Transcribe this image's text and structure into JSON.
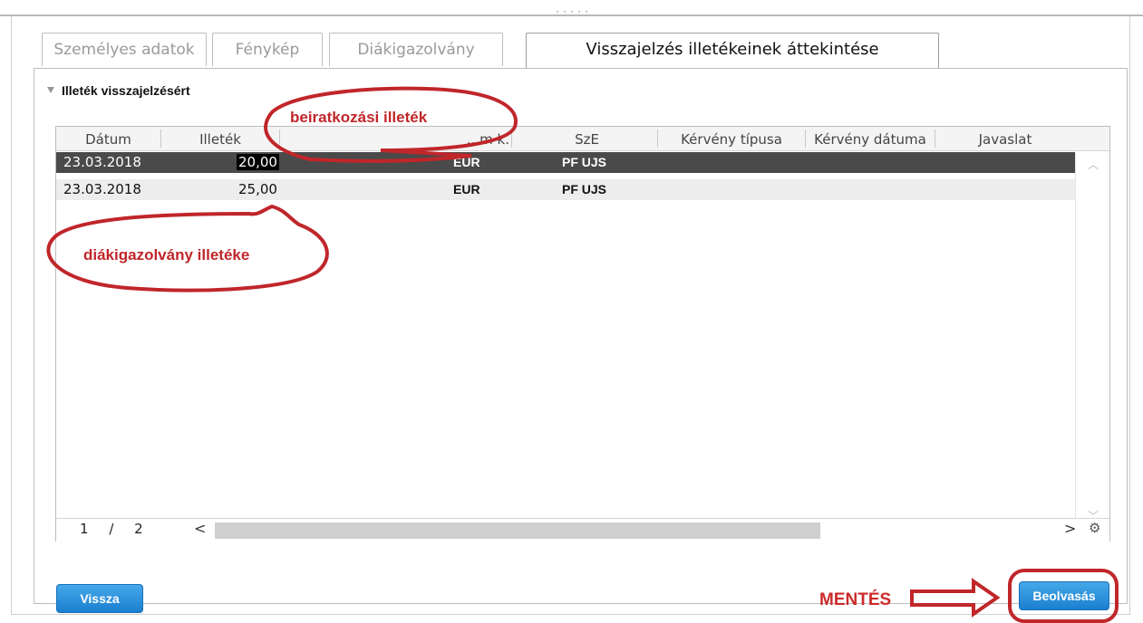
{
  "tabs": [
    {
      "label": "Személyes adatok",
      "active": false
    },
    {
      "label": "Fénykép",
      "active": false
    },
    {
      "label": "Diákigazolvány",
      "active": false
    },
    {
      "label": "Visszajelzés illetékeinek áttekintése",
      "active": true
    }
  ],
  "section": {
    "title": "Illeték visszajelzésért"
  },
  "grid": {
    "columns": [
      "Dátum",
      "Illeték",
      "Pénznem",
      "SzE",
      "Kérvény típusa",
      "Kérvény dátuma",
      "Javaslat"
    ],
    "visible_headers": [
      "Dátum",
      "Illeték",
      "...m k.",
      "SzE",
      "Kérvény típusa",
      "Kérvény dátuma",
      "Javaslat"
    ],
    "rows": [
      {
        "date": "23.03.2018",
        "fee": "20,00",
        "currency": "EUR",
        "sze": "PF UJS",
        "selected": true
      },
      {
        "date": "23.03.2018",
        "fee": "25,00",
        "currency": "EUR",
        "sze": "PF UJS",
        "selected": false
      }
    ],
    "pager": {
      "current": "1",
      "sep": "/",
      "total": "2"
    }
  },
  "buttons": {
    "back": "Vissza",
    "read": "Beolvasás"
  },
  "annotations": {
    "callout_top": "beiratkozási illeték",
    "callout_mid": "diákigazolvány illetéke",
    "save_label": "MENTÉS"
  },
  "colors": {
    "accent": "#1b7fd0",
    "annotation": "#c0262a",
    "selected_row": "#4a4a4a"
  }
}
